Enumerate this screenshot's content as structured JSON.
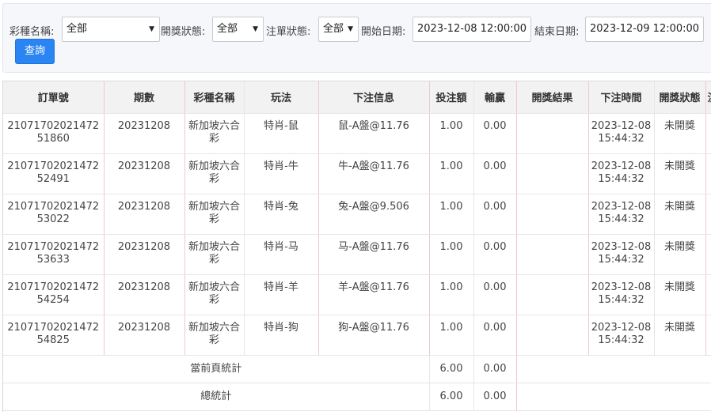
{
  "filters": {
    "lottery_label": "彩種名稱:",
    "lottery_value": "全部",
    "draw_status_label": "開獎狀態:",
    "draw_status_value": "全部",
    "bet_status_label": "注單狀態:",
    "bet_status_value": "全部",
    "start_label": "開始日期:",
    "start_value": "2023-12-08 12:00:00",
    "end_label": "結束日期:",
    "end_value": "2023-12-09 12:00:00",
    "query_button": "查詢"
  },
  "table": {
    "headers": [
      "訂單號",
      "期數",
      "彩種名稱",
      "玩法",
      "下注信息",
      "投注額",
      "輸贏",
      "開獎結果",
      "下注時間",
      "開獎狀態",
      "注"
    ],
    "rows": [
      {
        "order": "2107170202147251860",
        "period": "20231208",
        "lottery": "新加坡六合彩",
        "play": "特肖-鼠",
        "info": "鼠-A盤@11.76",
        "amount": "1.00",
        "winloss": "0.00",
        "result": "",
        "time": "2023-12-08 15:44:32",
        "status": "未開獎"
      },
      {
        "order": "2107170202147252491",
        "period": "20231208",
        "lottery": "新加坡六合彩",
        "play": "特肖-牛",
        "info": "牛-A盤@11.76",
        "amount": "1.00",
        "winloss": "0.00",
        "result": "",
        "time": "2023-12-08 15:44:32",
        "status": "未開獎"
      },
      {
        "order": "2107170202147253022",
        "period": "20231208",
        "lottery": "新加坡六合彩",
        "play": "特肖-兔",
        "info": "兔-A盤@9.506",
        "amount": "1.00",
        "winloss": "0.00",
        "result": "",
        "time": "2023-12-08 15:44:32",
        "status": "未開獎"
      },
      {
        "order": "2107170202147253633",
        "period": "20231208",
        "lottery": "新加坡六合彩",
        "play": "特肖-马",
        "info": "马-A盤@11.76",
        "amount": "1.00",
        "winloss": "0.00",
        "result": "",
        "time": "2023-12-08 15:44:32",
        "status": "未開獎"
      },
      {
        "order": "2107170202147254254",
        "period": "20231208",
        "lottery": "新加坡六合彩",
        "play": "特肖-羊",
        "info": "羊-A盤@11.76",
        "amount": "1.00",
        "winloss": "0.00",
        "result": "",
        "time": "2023-12-08 15:44:32",
        "status": "未開獎"
      },
      {
        "order": "2107170202147254825",
        "period": "20231208",
        "lottery": "新加坡六合彩",
        "play": "特肖-狗",
        "info": "狗-A盤@11.76",
        "amount": "1.00",
        "winloss": "0.00",
        "result": "",
        "time": "2023-12-08 15:44:32",
        "status": "未開獎"
      }
    ],
    "page_total": {
      "label": "當前頁統計",
      "amount": "6.00",
      "winloss": "0.00"
    },
    "grand_total": {
      "label": "總統計",
      "amount": "6.00",
      "winloss": "0.00"
    }
  }
}
